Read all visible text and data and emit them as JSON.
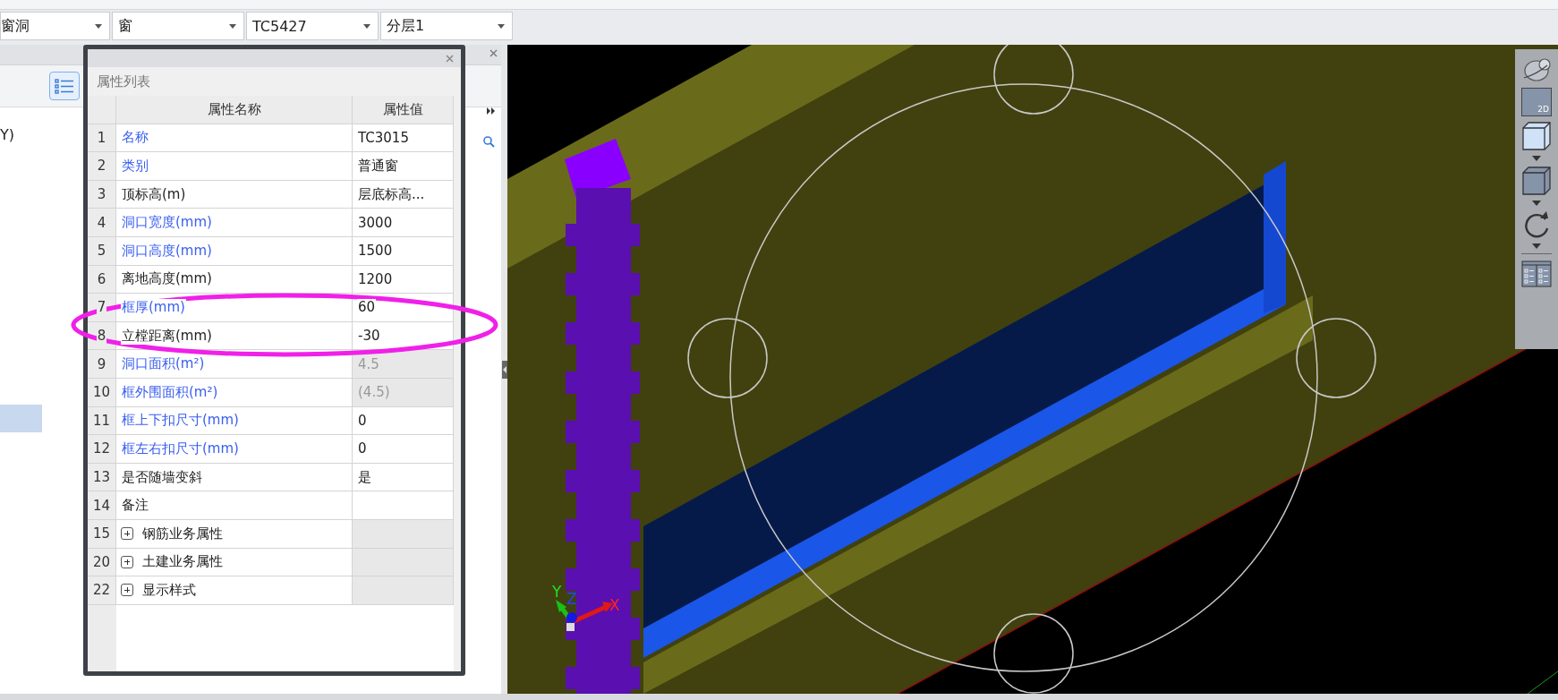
{
  "toolbar": {
    "dropdowns": [
      {
        "value": "窗洞"
      },
      {
        "value": "窗"
      },
      {
        "value": "TC5427"
      },
      {
        "value": "分层1"
      }
    ]
  },
  "left_panel": {
    "items": [
      {
        "label": "Y)",
        "selected": false
      }
    ]
  },
  "property_panel": {
    "title": "属性列表",
    "columns": [
      "属性名称",
      "属性值"
    ],
    "rows": [
      {
        "kind": "property",
        "index": "1",
        "name": "名称",
        "value": "TC3015",
        "public": true,
        "readonly": false
      },
      {
        "kind": "property",
        "index": "2",
        "name": "类别",
        "value": "普通窗",
        "public": true,
        "readonly": false
      },
      {
        "kind": "property",
        "index": "3",
        "name": "顶标高(m)",
        "value": "层底标高...",
        "public": false,
        "readonly": false
      },
      {
        "kind": "property",
        "index": "4",
        "name": "洞口宽度(mm)",
        "value": "3000",
        "public": true,
        "readonly": false
      },
      {
        "kind": "property",
        "index": "5",
        "name": "洞口高度(mm)",
        "value": "1500",
        "public": true,
        "readonly": false
      },
      {
        "kind": "property",
        "index": "6",
        "name": "离地高度(mm)",
        "value": "1200",
        "public": false,
        "readonly": false
      },
      {
        "kind": "property",
        "index": "7",
        "name": "框厚(mm)",
        "value": "60",
        "public": true,
        "readonly": false
      },
      {
        "kind": "property",
        "index": "8",
        "name": "立樘距离(mm)",
        "value": "-30",
        "public": false,
        "readonly": false
      },
      {
        "kind": "property",
        "index": "9",
        "name": "洞口面积(m²)",
        "value": "4.5",
        "public": true,
        "readonly": true
      },
      {
        "kind": "property",
        "index": "10",
        "name": "框外围面积(m²)",
        "value": "(4.5)",
        "public": true,
        "readonly": true
      },
      {
        "kind": "property",
        "index": "11",
        "name": "框上下扣尺寸(mm)",
        "value": "0",
        "public": true,
        "readonly": false
      },
      {
        "kind": "property",
        "index": "12",
        "name": "框左右扣尺寸(mm)",
        "value": "0",
        "public": true,
        "readonly": false
      },
      {
        "kind": "property",
        "index": "13",
        "name": "是否随墙变斜",
        "value": "是",
        "public": false,
        "readonly": false
      },
      {
        "kind": "property",
        "index": "14",
        "name": "备注",
        "public": false,
        "readonly": false
      },
      {
        "kind": "group",
        "index": "15",
        "name": "钢筋业务属性",
        "expanded": false
      },
      {
        "kind": "group",
        "index": "20",
        "name": "土建业务属性",
        "expanded": false
      },
      {
        "kind": "group",
        "index": "22",
        "name": "显示样式",
        "expanded": false
      }
    ]
  },
  "viewport": {
    "axes": {
      "x": "X",
      "y": "Y",
      "z": "Z"
    },
    "toolbar": {
      "view_2d_label": "2D"
    }
  }
}
